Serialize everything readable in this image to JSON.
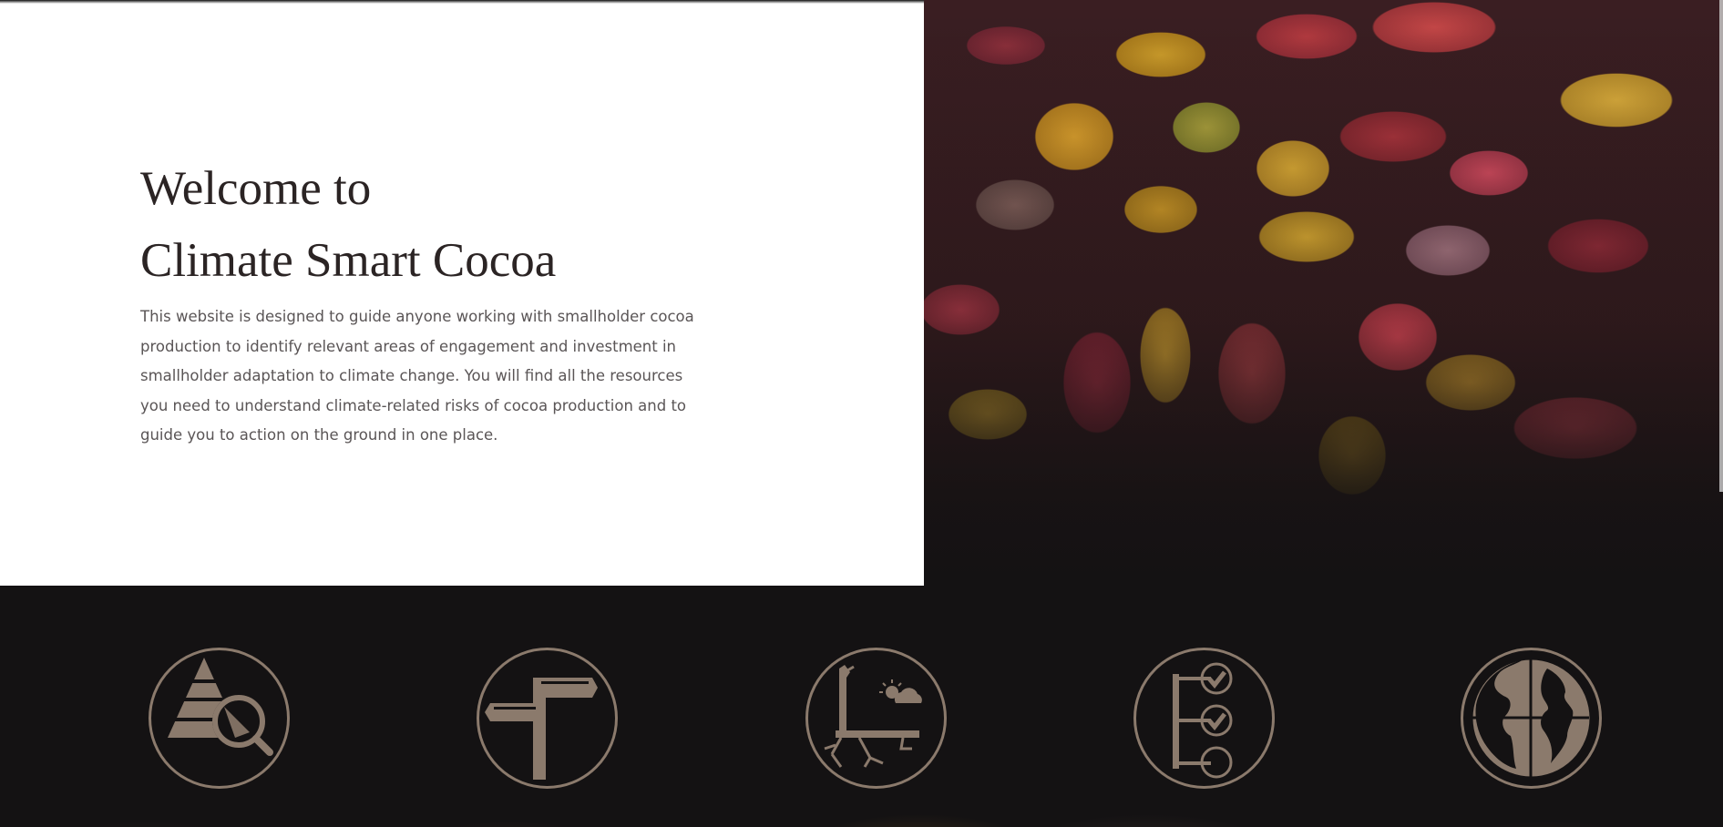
{
  "intro": {
    "title_line1": "Welcome to",
    "title_line2": "Climate Smart Cocoa",
    "description": "This website is designed to guide anyone working with smallholder cocoa production to identify relevant areas of engagement and investment in smallholder adaptation to climate change. You will find all the resources you need to understand climate-related risks of cocoa production and to guide you to action on the ground in one place."
  },
  "hero_image": {
    "subject": "cocoa-pods"
  },
  "colors": {
    "icon_tan": "#8b7a6c",
    "dark_band": "#141213",
    "title_text": "#2b2424",
    "body_text": "#5a5556"
  },
  "icons": [
    {
      "name": "pyramid-magnifier-icon"
    },
    {
      "name": "signpost-icon"
    },
    {
      "name": "tree-weather-icon"
    },
    {
      "name": "checklist-icon"
    },
    {
      "name": "globe-icon"
    }
  ]
}
